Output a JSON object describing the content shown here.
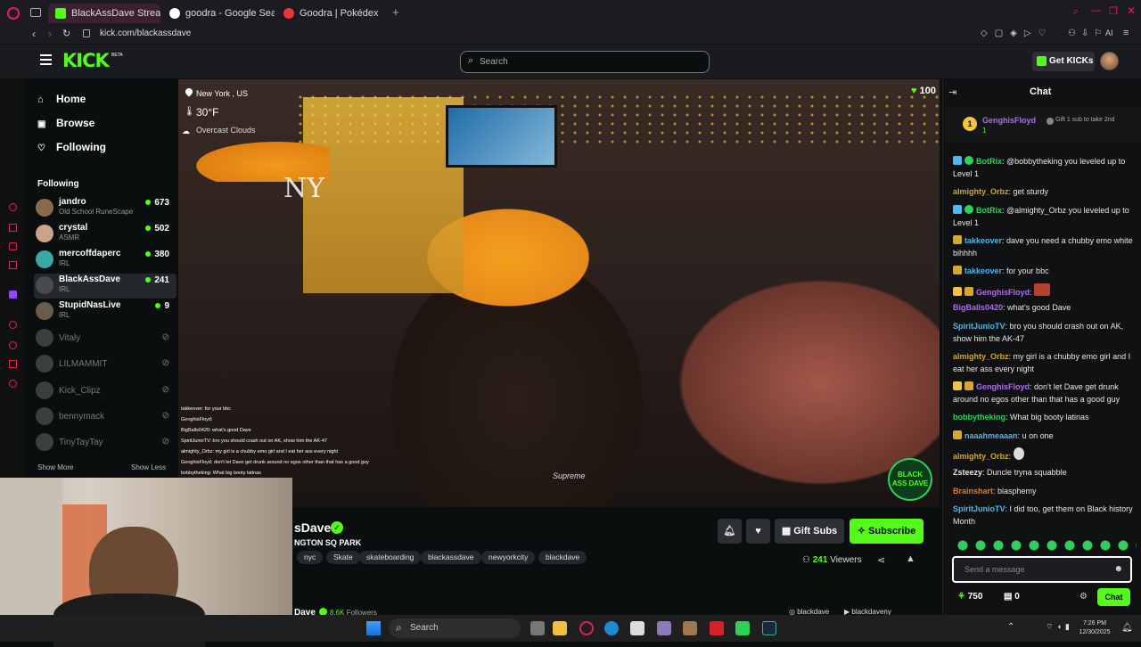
{
  "browser": {
    "tabs": [
      {
        "label": "BlackAssDave Stream"
      },
      {
        "label": "goodra - Google Search"
      },
      {
        "label": "Goodra | Pokédex"
      }
    ],
    "url": "kick.com/blackassdave"
  },
  "site": {
    "logo": "KICK",
    "logo_beta": "BETA",
    "search_placeholder": "Search",
    "get_kicks": "Get KICKs"
  },
  "sidebar": {
    "nav": [
      {
        "label": "Home"
      },
      {
        "label": "Browse"
      },
      {
        "label": "Following"
      }
    ],
    "section_title": "Following",
    "channels": [
      {
        "name": "jandro",
        "category": "Old School RuneScape",
        "viewers": "673"
      },
      {
        "name": "crystal",
        "category": "ASMR",
        "viewers": "502"
      },
      {
        "name": "mercoffdaperc",
        "category": "IRL",
        "viewers": "380"
      },
      {
        "name": "BlackAssDave",
        "category": "IRL",
        "viewers": "241"
      },
      {
        "name": "StupidNasLive",
        "category": "IRL",
        "viewers": "9"
      },
      {
        "name": "Vitaly"
      },
      {
        "name": "LILMAMMIT"
      },
      {
        "name": "Kick_Clipz"
      },
      {
        "name": "bennymack"
      },
      {
        "name": "TinyTayTay"
      }
    ],
    "show_more": "Show More",
    "show_less": "Show Less"
  },
  "video": {
    "location": "New York , US",
    "temp": "30°F",
    "weather": "Overcast Clouds",
    "overlay_count": "100",
    "shirt_text": "Supreme",
    "watermark": "BLACK ASS DAVE",
    "overlay_chat": [
      "takkeover: for your bbc",
      "GenghisFloyd: ",
      "BigBalls0420: what's good Dave",
      "SpiritJunioTV: bro you should crash out on AK, show him the AK-47",
      "almighty_Orbz: my girl is a chubby emo girl and I eat her ass every night",
      "GenghisFloyd: don't let Dave get drunk around no egos other than that has a good guy",
      "bobbytheking: What big booty latinas"
    ]
  },
  "stream": {
    "title_partial": "sDave",
    "subtitle_partial": "NGTON SQ PARK",
    "tags": [
      "nyc",
      "Skate",
      "skateboarding",
      "blackassdave",
      "newyorkcity",
      "blackdave"
    ],
    "gift_subs": "Gift Subs",
    "subscribe": "Subscribe",
    "viewers": "241",
    "viewers_label": "Viewers",
    "bottom_name": "Dave",
    "followers": "8.6K",
    "followers_label": "Followers",
    "social1": "blackdave",
    "social2": "blackdaveny"
  },
  "chat": {
    "title": "Chat",
    "pinned_user": "GenghisFloyd",
    "pinned_count": "1",
    "gift_text": "Gift 1 sub to take 2nd",
    "messages": [
      {
        "user": "BotRix",
        "text": "@bobbytheking you leveled up to Level 1",
        "color": "#2fd05c"
      },
      {
        "user": "almighty_Orbz",
        "text": "get sturdy",
        "color": "#d4a82b"
      },
      {
        "user": "BotRix",
        "text": "@almighty_Orbz you leveled up to Level 1",
        "color": "#2fd05c"
      },
      {
        "user": "takkeover",
        "text": "dave you need a chubby emo white bihhhh",
        "color": "#4fb8f0"
      },
      {
        "user": "takkeover",
        "text": "for your bbc",
        "color": "#4fb8f0"
      },
      {
        "user": "GenghisFloyd",
        "text": "",
        "color": "#b26cf0"
      },
      {
        "user": "BigBalls0420",
        "text": "what's good Dave",
        "color": "#b26cf0"
      },
      {
        "user": "SpiritJunioTV",
        "text": "bro you should crash out on AK, show him the AK-47",
        "color": "#4fb8f0"
      },
      {
        "user": "almighty_Orbz",
        "text": "my girl is a chubby emo girl and I eat her ass every night",
        "color": "#d4a82b"
      },
      {
        "user": "GenghisFloyd",
        "text": "don't let Dave get drunk around no egos other than that has a good guy",
        "color": "#b26cf0"
      },
      {
        "user": "bobbytheking",
        "text": "What big booty latinas",
        "color": "#2fd05c"
      },
      {
        "user": "naaahmeaaan",
        "text": "u on one",
        "color": "#4fb8f0"
      },
      {
        "user": "almighty_Orbz",
        "text": "",
        "color": "#d4a82b"
      },
      {
        "user": "Zsteezy",
        "text": "Duncle tryna squabble",
        "color": "#e8e8e8"
      },
      {
        "user": "Brainshart",
        "text": "blasphemy",
        "color": "#e67a2c"
      },
      {
        "user": "SpiritJunioTV",
        "text": "I did too, get them on Black history Month",
        "color": "#4fb8f0"
      }
    ],
    "input_placeholder": "Send a message",
    "points": "750",
    "store_count": "0",
    "send": "Chat"
  },
  "taskbar": {
    "search": "Search",
    "time": "7:26 PM",
    "date": "12/30/2025"
  },
  "colors": {
    "accent": "#53fc18",
    "bg": "#0b0e0f"
  }
}
